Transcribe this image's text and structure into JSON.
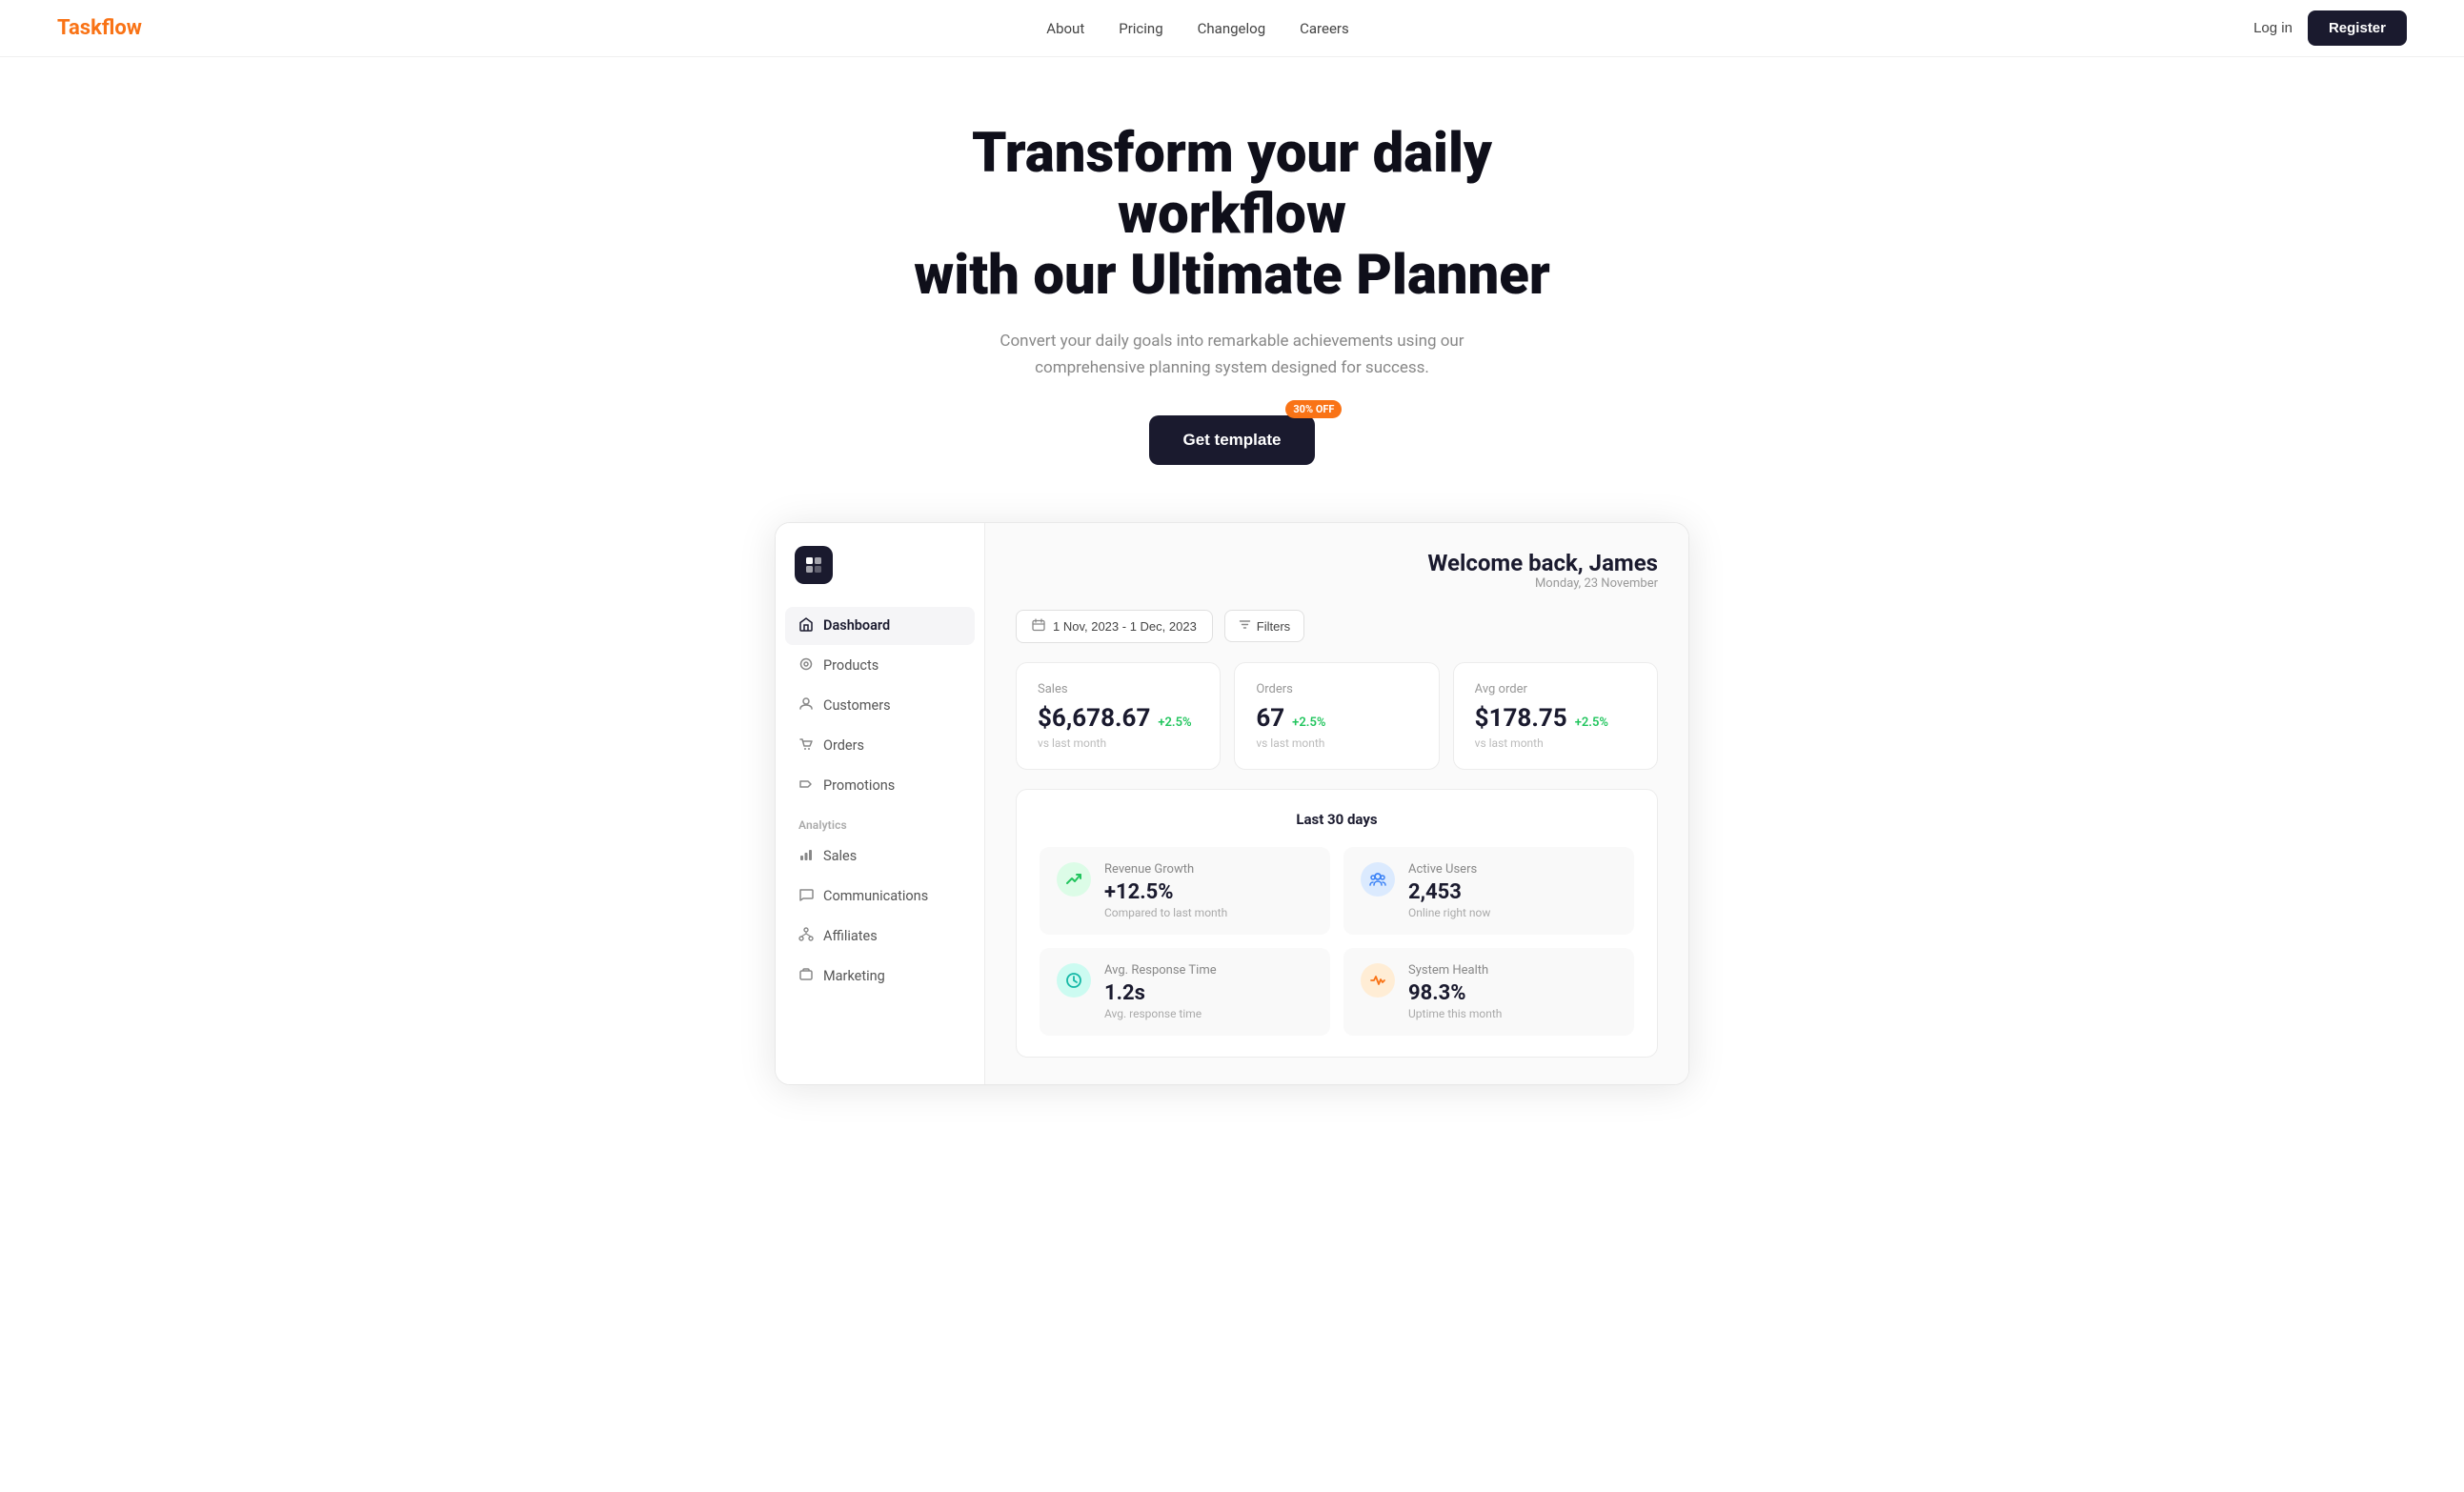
{
  "navbar": {
    "logo_text": "Task",
    "logo_accent": "flow",
    "links": [
      {
        "label": "About",
        "href": "#"
      },
      {
        "label": "Pricing",
        "href": "#"
      },
      {
        "label": "Changelog",
        "href": "#"
      },
      {
        "label": "Careers",
        "href": "#"
      }
    ],
    "login_label": "Log in",
    "register_label": "Register"
  },
  "hero": {
    "headline_line1": "Transform your daily workflow",
    "headline_line2": "with our Ultimate Planner",
    "subtext": "Convert your daily goals into remarkable achievements using our comprehensive planning system designed for success.",
    "badge": "30% OFF",
    "cta_label": "Get template"
  },
  "sidebar": {
    "logo_icon": "⬡",
    "nav_items": [
      {
        "label": "Dashboard",
        "icon": "⌂",
        "active": true
      },
      {
        "label": "Products",
        "icon": "◎"
      },
      {
        "label": "Customers",
        "icon": "👤"
      },
      {
        "label": "Orders",
        "icon": "🛒"
      },
      {
        "label": "Promotions",
        "icon": "📢"
      }
    ],
    "section_label": "Analytics",
    "analytics_items": [
      {
        "label": "Sales",
        "icon": "📊"
      },
      {
        "label": "Communications",
        "icon": "💬"
      },
      {
        "label": "Affiliates",
        "icon": "⛓"
      },
      {
        "label": "Marketing",
        "icon": "✉"
      }
    ]
  },
  "dashboard": {
    "welcome_title": "Welcome back, James",
    "welcome_date": "Monday, 23 November",
    "date_range": "1 Nov, 2023 - 1 Dec, 2023",
    "filters_label": "Filters",
    "stats": [
      {
        "label": "Sales",
        "value": "$6,678.67",
        "change": "+2.5%",
        "vs": "vs last month"
      },
      {
        "label": "Orders",
        "value": "67",
        "change": "+2.5%",
        "vs": "vs last month"
      },
      {
        "label": "Avg order",
        "value": "$178.75",
        "change": "+2.5%",
        "vs": "vs last month"
      }
    ],
    "last30_title": "Last 30 days",
    "metrics": [
      {
        "name": "Revenue Growth",
        "value": "+12.5%",
        "sub": "Compared to last month",
        "icon": "📈",
        "color": "green"
      },
      {
        "name": "Active Users",
        "value": "2,453",
        "sub": "Online right now",
        "icon": "👥",
        "color": "blue"
      },
      {
        "name": "Avg. Response Time",
        "value": "1.2s",
        "sub": "Avg. response time",
        "icon": "⏱",
        "color": "teal"
      },
      {
        "name": "System Health",
        "value": "98.3%",
        "sub": "Uptime this month",
        "icon": "📉",
        "color": "orange"
      }
    ]
  }
}
